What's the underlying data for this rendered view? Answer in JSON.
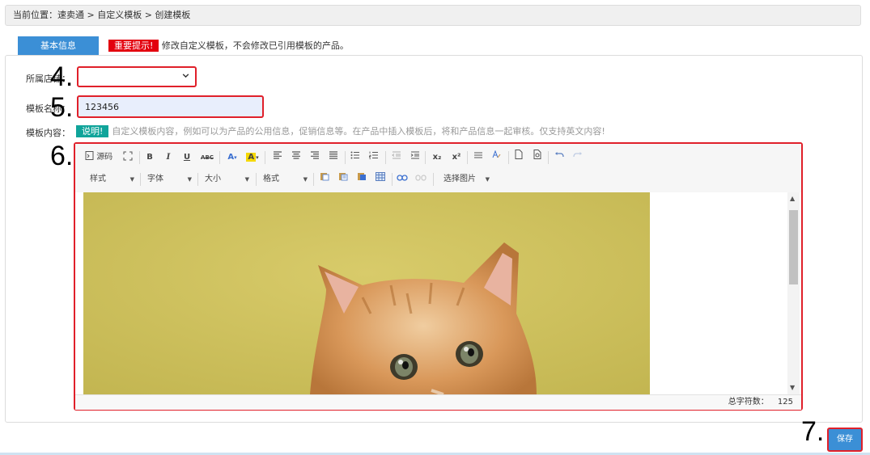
{
  "breadcrumb": {
    "prefix": "当前位置：",
    "path": "速卖通 > 自定义模板 > 创建模板"
  },
  "tab": {
    "label": "基本信息"
  },
  "notice": {
    "badge": "重要提示!",
    "text": "修改自定义模板，不会修改已引用模板的产品。"
  },
  "form": {
    "store_label": "所属店铺：",
    "store_value": "",
    "name_label": "模板名称：",
    "name_value": "123456",
    "content_label": "模板内容：",
    "content_badge": "说明!",
    "content_hint": "自定义模板内容，例如可以为产品的公用信息，促销信息等。在产品中插入模板后，将和产品信息一起审核。仅支持英文内容!"
  },
  "editor": {
    "toolbar_row1": {
      "source": "源码",
      "bold": "B",
      "italic": "I",
      "underline": "U",
      "strike": "ABC",
      "font_color": "A",
      "bg_color": "A",
      "subscript": "x₂",
      "superscript": "x²"
    },
    "toolbar_row2": {
      "style": "样式",
      "font": "字体",
      "size": "大小",
      "format": "格式",
      "choose_image": "选择图片"
    },
    "status_label": "总字符数：",
    "status_count": "125"
  },
  "steps": {
    "s4": "4.",
    "s5": "5.",
    "s6": "6.",
    "s7": "7."
  },
  "save": {
    "label": "保存"
  },
  "colors": {
    "accent": "#3b8fd6",
    "highlight": "#e0202a",
    "notice": "#e3000e",
    "info": "#10a49a"
  }
}
